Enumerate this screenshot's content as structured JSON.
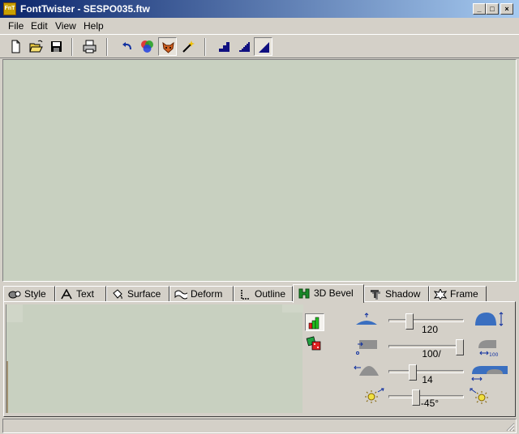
{
  "window": {
    "title": "FontTwister - SESPO035.ftw",
    "app_icon_text": "FnT"
  },
  "menu": {
    "file": "File",
    "edit": "Edit",
    "view": "View",
    "help": "Help"
  },
  "toolbar": {
    "buttons": [
      "new-icon",
      "open-icon",
      "save-icon",
      "print-icon",
      "undo-icon",
      "color-icon",
      "fox-icon",
      "magic-wand-icon",
      "quality-low-icon",
      "quality-medium-icon",
      "quality-high-icon"
    ],
    "pressed": [
      "fox-icon",
      "quality-high-icon"
    ]
  },
  "tabs": [
    {
      "label": "Style",
      "icon": "style-icon"
    },
    {
      "label": "Text",
      "icon": "text-icon"
    },
    {
      "label": "Surface",
      "icon": "surface-icon"
    },
    {
      "label": "Deform",
      "icon": "deform-icon"
    },
    {
      "label": "Outline",
      "icon": "outline-icon"
    },
    {
      "label": "3D Bevel",
      "icon": "bevel-icon",
      "active": true
    },
    {
      "label": "Shadow",
      "icon": "shadow-icon"
    },
    {
      "label": "Frame",
      "icon": "frame-icon"
    }
  ],
  "bevel": {
    "height": {
      "value": "120",
      "level": 0.25
    },
    "profile": {
      "value": "100/",
      "level": 1.0
    },
    "width": {
      "value": "14",
      "level": 0.3
    },
    "light": {
      "value": "-45°",
      "level": 0.35
    }
  },
  "colors": {
    "canvas": "#c8d0c0",
    "face": "#d4d0c8",
    "icon_blue": "#3a6fc0",
    "titlebar": "#0a246a"
  }
}
